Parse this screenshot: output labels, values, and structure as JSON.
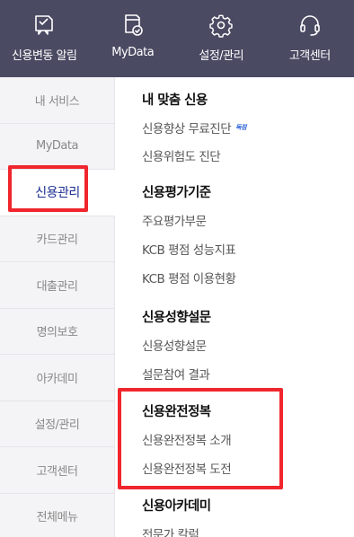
{
  "topbar": {
    "items": [
      {
        "label": "신용변동 알림",
        "icon": "credit-alert-icon"
      },
      {
        "label": "MyData",
        "icon": "mydata-icon"
      },
      {
        "label": "설정/관리",
        "icon": "gear-icon"
      },
      {
        "label": "고객센터",
        "icon": "headset-icon"
      }
    ]
  },
  "sidebar": {
    "items": [
      {
        "label": "내 서비스"
      },
      {
        "label": "MyData"
      },
      {
        "label": "신용관리",
        "active": true
      },
      {
        "label": "카드관리"
      },
      {
        "label": "대출관리"
      },
      {
        "label": "명의보호"
      },
      {
        "label": "아카데미"
      },
      {
        "label": "설정/관리"
      },
      {
        "label": "고객센터"
      },
      {
        "label": "전체메뉴"
      }
    ]
  },
  "content": {
    "sections": [
      {
        "title": "내 맞춤 신용",
        "links": [
          {
            "label": "신용향상 무료진단",
            "badge": "독점"
          },
          {
            "label": "신용위험도 진단"
          }
        ]
      },
      {
        "title": "신용평가기준",
        "links": [
          {
            "label": "주요평가부문"
          },
          {
            "label": "KCB 평점 성능지표"
          },
          {
            "label": "KCB 평점 이용현황"
          }
        ]
      },
      {
        "title": "신용성향설문",
        "links": [
          {
            "label": "신용성향설문"
          },
          {
            "label": "설문참여 결과"
          }
        ]
      },
      {
        "title": "신용완전정복",
        "links": [
          {
            "label": "신용완전정복 소개"
          },
          {
            "label": "신용완전정복 도전"
          }
        ]
      },
      {
        "title": "신용아카데미",
        "links": [
          {
            "label": "전문가 칼럼"
          }
        ]
      }
    ]
  },
  "colors": {
    "topbar": "#4b4a63",
    "active_text": "#1a2d8f",
    "highlight": "#f0262d",
    "badge": "#2d63d6"
  }
}
